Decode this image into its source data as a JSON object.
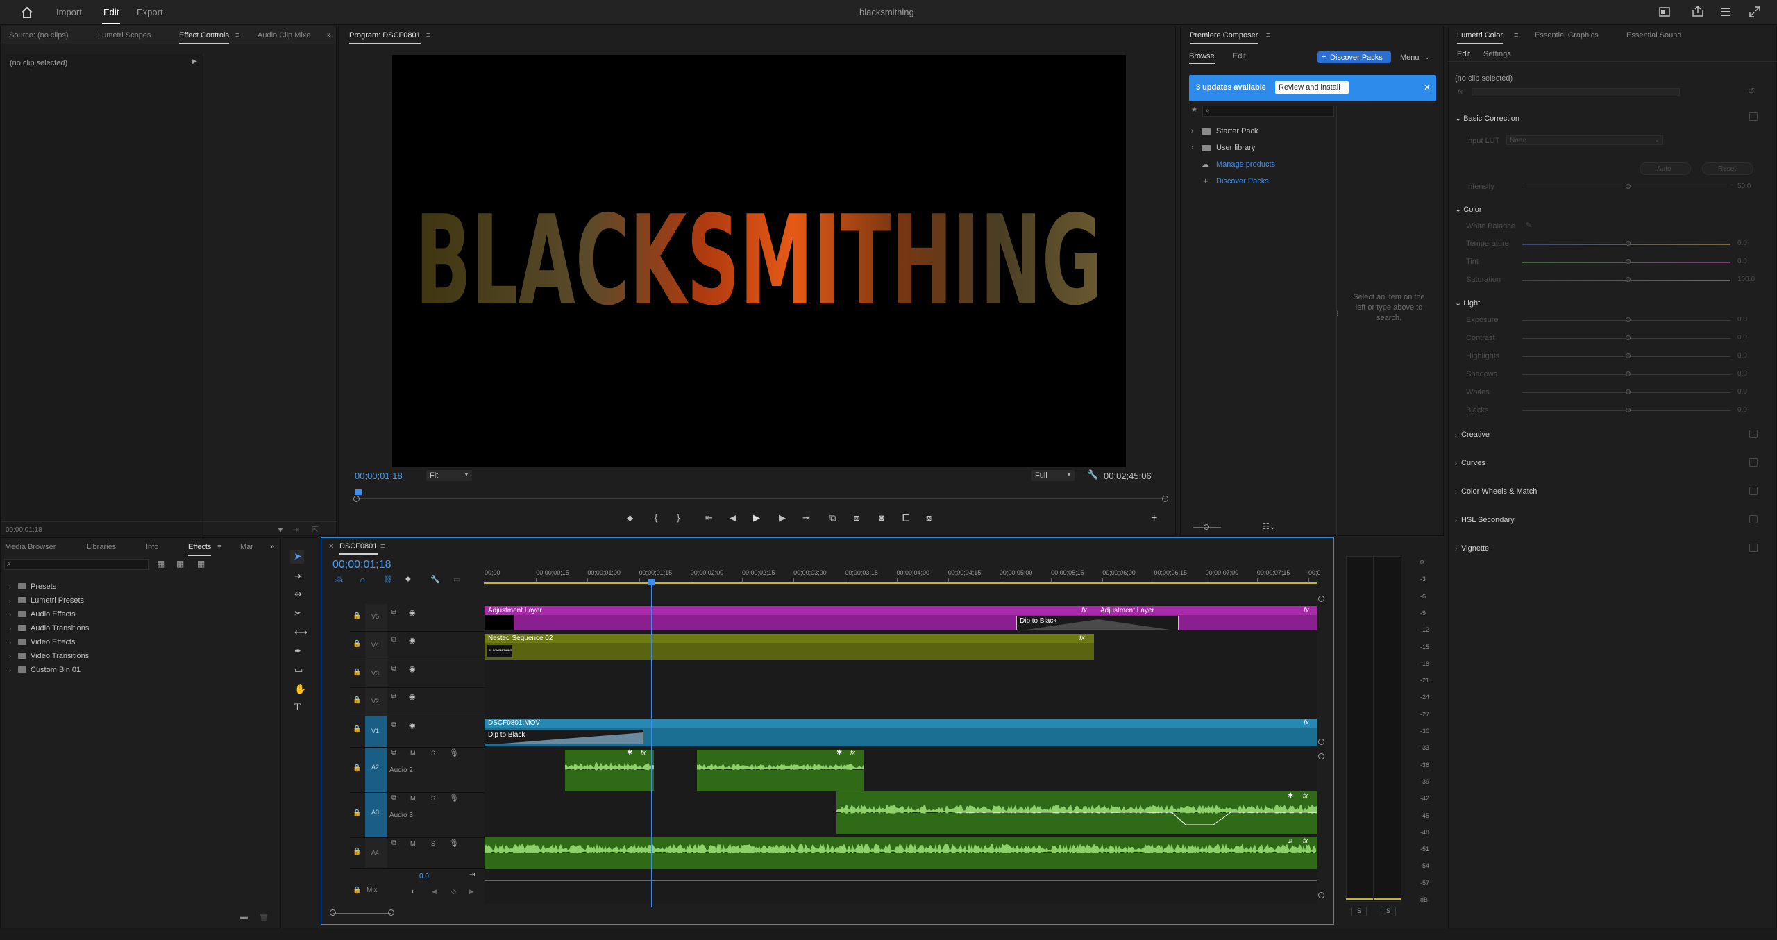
{
  "topbar": {
    "home": "home-icon",
    "import": "Import",
    "edit": "Edit",
    "export": "Export",
    "project": "blacksmithing"
  },
  "source_panel": {
    "tabs": [
      "Source: (no clips)",
      "Lumetri Scopes",
      "Effect Controls",
      "Audio Clip Mixe"
    ],
    "no_clip": "(no clip selected)",
    "timecode": "00;00;01;18"
  },
  "program": {
    "title": "Program: DSCF0801",
    "video_text": "BLACKSMITHING",
    "timecode": "00;00;01;18",
    "fit": "Fit",
    "quality": "Full",
    "duration": "00;02;45;06"
  },
  "composer": {
    "title": "Premiere Composer",
    "tabs": [
      "Browse",
      "Edit"
    ],
    "discover_btn": "Discover Packs",
    "menu": "Menu",
    "updates": "3 updates available",
    "review": "Review and install",
    "tree": [
      "Starter Pack",
      "User library"
    ],
    "links": [
      "Manage products",
      "Discover Packs"
    ],
    "hint": "Select an item on the left or type above to search."
  },
  "lumetri": {
    "tabs": [
      "Lumetri Color",
      "Essential Graphics",
      "Essential Sound"
    ],
    "subtabs": [
      "Edit",
      "Settings"
    ],
    "no_clip": "(no clip selected)",
    "basic": "Basic Correction",
    "input_lut": "Input LUT",
    "lut_value": "None",
    "auto": "Auto",
    "reset": "Reset",
    "intensity": {
      "label": "Intensity",
      "value": "50.0"
    },
    "color": "Color",
    "white_balance": "White Balance",
    "color_rows": [
      {
        "label": "Temperature",
        "value": "0.0"
      },
      {
        "label": "Tint",
        "value": "0.0"
      },
      {
        "label": "Saturation",
        "value": "100.0"
      }
    ],
    "light": "Light",
    "light_rows": [
      {
        "label": "Exposure",
        "value": "0.0"
      },
      {
        "label": "Contrast",
        "value": "0.0"
      },
      {
        "label": "Highlights",
        "value": "0.0"
      },
      {
        "label": "Shadows",
        "value": "0.0"
      },
      {
        "label": "Whites",
        "value": "0.0"
      },
      {
        "label": "Blacks",
        "value": "0.0"
      }
    ],
    "sections": [
      "Creative",
      "Curves",
      "Color Wheels & Match",
      "HSL Secondary",
      "Vignette"
    ]
  },
  "project_panel": {
    "tabs": [
      "Media Browser",
      "Libraries",
      "Info",
      "Effects",
      "Mar"
    ],
    "bins": [
      "Presets",
      "Lumetri Presets",
      "Audio Effects",
      "Audio Transitions",
      "Video Effects",
      "Video Transitions",
      "Custom Bin 01"
    ]
  },
  "timeline": {
    "sequence": "DSCF0801",
    "timecode": "00;00;01;18",
    "ruler": [
      "00;00",
      "00;00;00;15",
      "00;00;01;00",
      "00;00;01;15",
      "00;00;02;00",
      "00;00;02;15",
      "00;00;03;00",
      "00;00;03;15",
      "00;00;04;00",
      "00;00;04;15",
      "00;00;05;00",
      "00;00;05;15",
      "00;00;06;00",
      "00;00;06;15",
      "00;00;07;00",
      "00;00;07;15",
      "00;0"
    ],
    "tracks": {
      "v5": "V5",
      "v4": "V4",
      "v3": "V3",
      "v2": "V2",
      "v1": "V1",
      "a2": "A2",
      "a3": "A3",
      "a4": "A4",
      "a2_name": "Audio 2",
      "a3_name": "Audio 3",
      "mix": "Mix",
      "mix_val": "0.0"
    },
    "clips": {
      "adj1": "Adjustment Layer",
      "adj2": "Adjustment Layer",
      "dip1": "Dip to Black",
      "nested": "Nested Sequence 02",
      "v1clip": "DSCF0801.MOV",
      "dip2": "Dip to Black",
      "fx": "fx",
      "thumb": "BLACKSMITHING"
    }
  },
  "meter": {
    "ticks": [
      "0",
      "-3",
      "-6",
      "-9",
      "-12",
      "-15",
      "-18",
      "-21",
      "-24",
      "-27",
      "-30",
      "-33",
      "-36",
      "-39",
      "-42",
      "-45",
      "-48",
      "-51",
      "-54",
      "-57",
      "dB"
    ],
    "solo": "S"
  },
  "colors": {
    "accent": "#2d8ceb",
    "adjustment": "#8a1f8f",
    "nested": "#5a6410",
    "video": "#1b6f92",
    "audio": "#2f6a17"
  }
}
